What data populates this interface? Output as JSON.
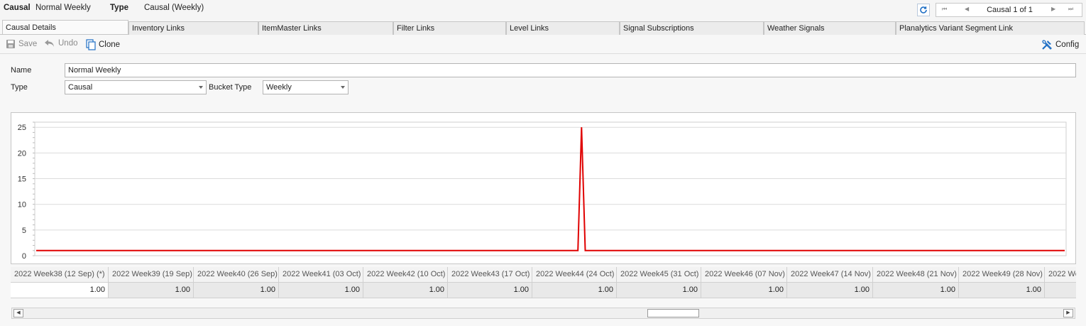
{
  "header": {
    "causal_label": "Causal",
    "causal_value": "Normal Weekly",
    "type_label": "Type",
    "type_value": "Causal (Weekly)"
  },
  "navigator": {
    "text": "Causal 1 of 1",
    "first_icon": "first-page-icon",
    "prev_icon": "prev-page-icon",
    "next_icon": "next-page-icon",
    "last_icon": "last-page-icon"
  },
  "tabs": [
    {
      "label": "Causal Details",
      "active": true
    },
    {
      "label": "Inventory Links"
    },
    {
      "label": "ItemMaster Links"
    },
    {
      "label": "Filter Links"
    },
    {
      "label": "Level Links"
    },
    {
      "label": "Signal Subscriptions"
    },
    {
      "label": "Weather Signals"
    },
    {
      "label": "Planalytics Variant Segment Link"
    }
  ],
  "toolbar": {
    "save": "Save",
    "undo": "Undo",
    "clone": "Clone",
    "config": "Config"
  },
  "form": {
    "name_label": "Name",
    "name_value": "Normal Weekly",
    "type_label": "Type",
    "type_value": "Causal",
    "bucket_type_label": "Bucket Type",
    "bucket_type_value": "Weekly"
  },
  "colors": {
    "series": "#e00000",
    "accent": "#1f6fc5"
  },
  "chart_data": {
    "type": "line",
    "ylim": [
      0,
      26
    ],
    "yticks": [
      0,
      5,
      10,
      15,
      20,
      25
    ],
    "grid": true,
    "series": [
      {
        "values": [
          1,
          1,
          1,
          1,
          1,
          1,
          1,
          1,
          1,
          1,
          1,
          1,
          1,
          1,
          1,
          1,
          1,
          1,
          1,
          1,
          1,
          1,
          1,
          1,
          1,
          1,
          1,
          1,
          1,
          1,
          1,
          1,
          1,
          1,
          1,
          1,
          1,
          1,
          1,
          1,
          1,
          1,
          1,
          1,
          1,
          1,
          1,
          1,
          1,
          1,
          1,
          1,
          1,
          1,
          1,
          1,
          1,
          1,
          1,
          1,
          1,
          1,
          1,
          1,
          1,
          1,
          1,
          1,
          1,
          1,
          1,
          1,
          1,
          1,
          1,
          1,
          1,
          1,
          1,
          1,
          1,
          1,
          1,
          1,
          1,
          1,
          1,
          1,
          1,
          1,
          1,
          1,
          1,
          1,
          1,
          1,
          1,
          1,
          1,
          1,
          1,
          1,
          1,
          1,
          1,
          1,
          1,
          1,
          1,
          1,
          1,
          1,
          1,
          1,
          1,
          1,
          1,
          1,
          1,
          1,
          1,
          1,
          1,
          1,
          1,
          1,
          1,
          1,
          1,
          1,
          1,
          1,
          1,
          1,
          1,
          1,
          1,
          1,
          1,
          1,
          1,
          1,
          1,
          1,
          1,
          1,
          1,
          1,
          1,
          25,
          1,
          1,
          1,
          1,
          1,
          1,
          1,
          1,
          1,
          1,
          1,
          1,
          1,
          1,
          1,
          1,
          1,
          1,
          1,
          1,
          1,
          1,
          1,
          1,
          1,
          1,
          1,
          1,
          1,
          1,
          1,
          1,
          1,
          1,
          1,
          1,
          1,
          1,
          1,
          1,
          1,
          1,
          1,
          1,
          1,
          1,
          1,
          1,
          1,
          1,
          1,
          1,
          1,
          1,
          1,
          1,
          1,
          1,
          1,
          1,
          1,
          1,
          1,
          1,
          1,
          1,
          1,
          1,
          1,
          1,
          1,
          1,
          1,
          1,
          1,
          1,
          1,
          1,
          1,
          1,
          1,
          1,
          1,
          1,
          1,
          1,
          1,
          1,
          1,
          1,
          1,
          1,
          1,
          1,
          1,
          1,
          1,
          1,
          1,
          1,
          1,
          1,
          1,
          1,
          1,
          1,
          1,
          1,
          1,
          1,
          1,
          1,
          1,
          1,
          1,
          1,
          1,
          1,
          1,
          1,
          1,
          1,
          1,
          1,
          1,
          1,
          1,
          1,
          1,
          1,
          1,
          1
        ]
      }
    ]
  },
  "grid": {
    "columns": [
      {
        "header": "2022 Week38 (12 Sep) (*)",
        "value": "1.00"
      },
      {
        "header": "2022 Week39 (19 Sep)",
        "value": "1.00"
      },
      {
        "header": "2022 Week40 (26 Sep)",
        "value": "1.00"
      },
      {
        "header": "2022 Week41 (03 Oct)",
        "value": "1.00"
      },
      {
        "header": "2022 Week42 (10 Oct)",
        "value": "1.00"
      },
      {
        "header": "2022 Week43 (17 Oct)",
        "value": "1.00"
      },
      {
        "header": "2022 Week44 (24 Oct)",
        "value": "1.00"
      },
      {
        "header": "2022 Week45 (31 Oct)",
        "value": "1.00"
      },
      {
        "header": "2022 Week46 (07 Nov)",
        "value": "1.00"
      },
      {
        "header": "2022 Week47 (14 Nov)",
        "value": "1.00"
      },
      {
        "header": "2022 Week48 (21 Nov)",
        "value": "1.00"
      },
      {
        "header": "2022 Week49 (28 Nov)",
        "value": "1.00"
      },
      {
        "header": "2022 We",
        "value": ""
      }
    ]
  }
}
